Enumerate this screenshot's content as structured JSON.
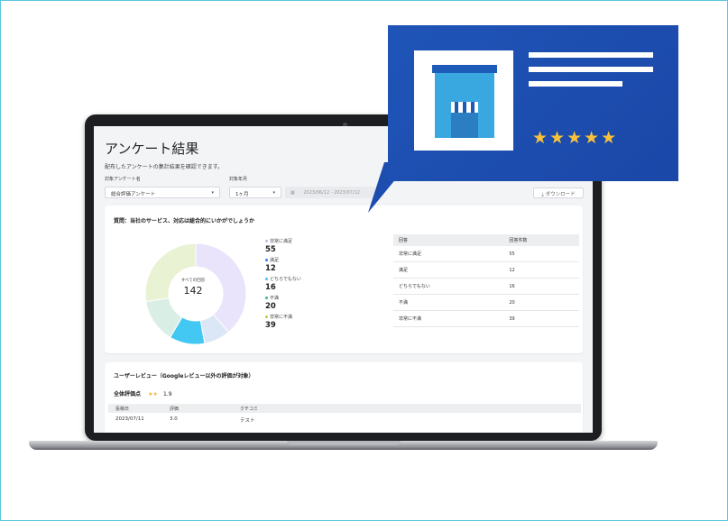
{
  "page": {
    "title": "アンケート結果",
    "description": "配布したアンケートの集計結果を確認できます。"
  },
  "filters": {
    "survey_label": "対象アンケート名",
    "survey_value": "総合評価アンケート",
    "period_label": "対象年月",
    "period_value": "1ヶ月",
    "date_range": "2023/06/12 - 2023/07/12",
    "download_label": "ダウンロード"
  },
  "question_card": {
    "question": "質問：当社のサービス、対応は総合的にいかがでしょうか",
    "center_label": "すべての回答",
    "center_value": "142",
    "legend": [
      {
        "label": "非常に満足",
        "value": "55",
        "color": "#c9b7f2"
      },
      {
        "label": "満足",
        "value": "12",
        "color": "#3b7be0"
      },
      {
        "label": "どちらでもない",
        "value": "16",
        "color": "#41c5ef"
      },
      {
        "label": "不満",
        "value": "20",
        "color": "#3cb97a"
      },
      {
        "label": "非常に不満",
        "value": "39",
        "color": "#b5d23f"
      }
    ]
  },
  "answers_table": {
    "headers": [
      "回答",
      "回答件数"
    ],
    "rows": [
      [
        "非常に満足",
        "55"
      ],
      [
        "満足",
        "12"
      ],
      [
        "どちらでもない",
        "16"
      ],
      [
        "不満",
        "20"
      ],
      [
        "非常に不満",
        "39"
      ]
    ]
  },
  "review_card": {
    "title": "ユーザーレビュー（Googleレビュー以外の評価が対象）",
    "overall_label": "全体評価点",
    "overall_stars": "★★",
    "overall_score": "1.9",
    "headers": [
      "投稿日",
      "評価",
      "クチコミ"
    ],
    "rows": [
      [
        "2023/07/11",
        "3.0",
        "テスト"
      ]
    ]
  },
  "bubble": {
    "stars": "★★★★★",
    "colors": {
      "background": "#1f55b7",
      "store_roof": "#1e5bb8",
      "store_wall": "#3aa8e0",
      "star": "#f7c23a"
    }
  }
}
